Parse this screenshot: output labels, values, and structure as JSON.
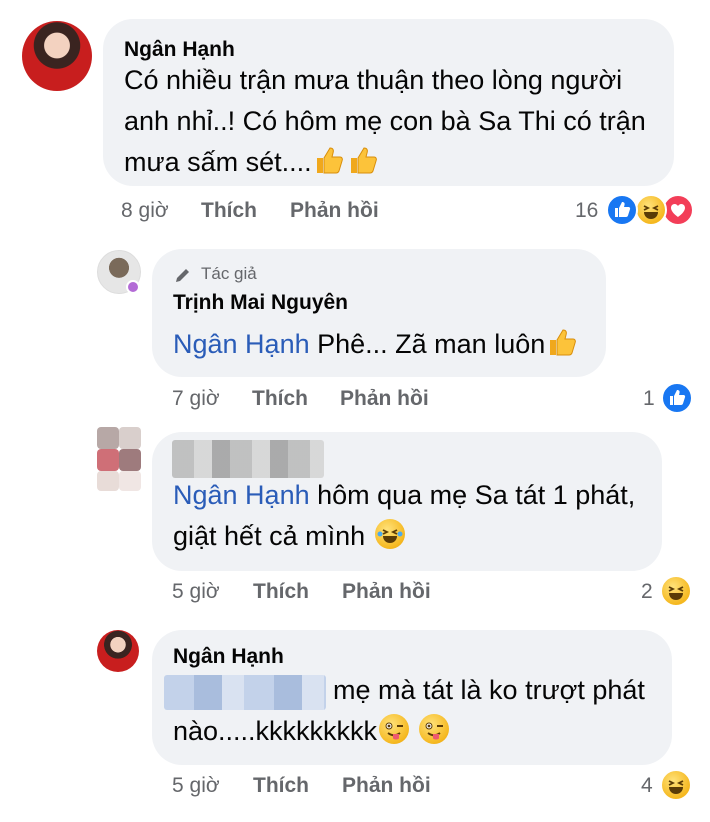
{
  "comments": [
    {
      "author": "Ngân Hạnh",
      "lines": [
        "Có nhiều trận mưa thuận theo lòng người",
        "anh nhỉ..! Có hôm mẹ con bà Sa Thi có trận",
        "mưa sấm sét...."
      ],
      "time": "8 giờ",
      "like_label": "Thích",
      "reply_label": "Phản hồi",
      "reaction_count": "16",
      "reactions": [
        "like-icon",
        "haha-icon",
        "love-icon"
      ]
    },
    {
      "badge": "Tác giả",
      "author": "Trịnh Mai Nguyên",
      "mention": "Ngân Hạnh",
      "text": " Phê... Zã man luôn",
      "time": "7 giờ",
      "like_label": "Thích",
      "reply_label": "Phản hồi",
      "reaction_count": "1",
      "reactions": [
        "like-icon"
      ]
    },
    {
      "mention": "Ngân Hạnh",
      "text_line1": " hôm qua mẹ Sa tát 1 phát,",
      "text_line2": "giật hết cả mình",
      "time": "5 giờ",
      "like_label": "Thích",
      "reply_label": "Phản hồi",
      "reaction_count": "2",
      "reactions": [
        "haha-icon"
      ]
    },
    {
      "author": "Ngân Hạnh",
      "text_line1": "mẹ mà tát là ko trượt phát",
      "text_line2": "nào.....kkkkkkkkk",
      "time": "5 giờ",
      "like_label": "Thích",
      "reply_label": "Phản hồi",
      "reaction_count": "4",
      "reactions": [
        "haha-icon"
      ]
    }
  ],
  "colors": {
    "bubble": "#f0f2f5",
    "mention": "#2a5cb8",
    "meta": "#65676b",
    "like": "#1877f2",
    "love": "#f33e58"
  }
}
